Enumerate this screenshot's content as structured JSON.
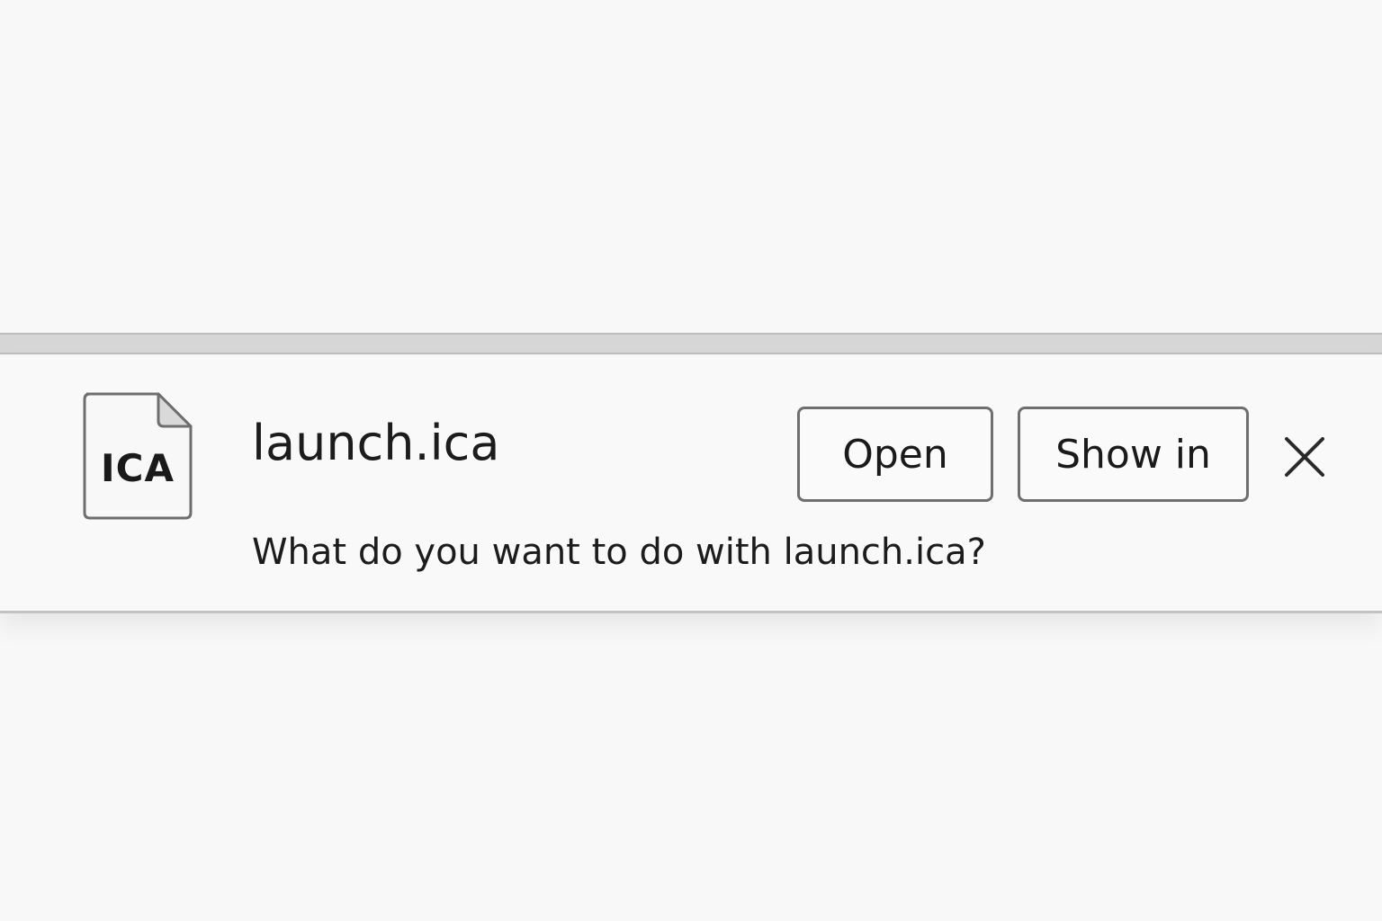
{
  "download_bar": {
    "file_icon_label": "ICA",
    "filename": "launch.ica",
    "prompt": "What do you want to do with launch.ica?",
    "open_label": "Open",
    "show_in_label": "Show in",
    "close_icon": "close-icon",
    "file_icon": "file-icon"
  }
}
